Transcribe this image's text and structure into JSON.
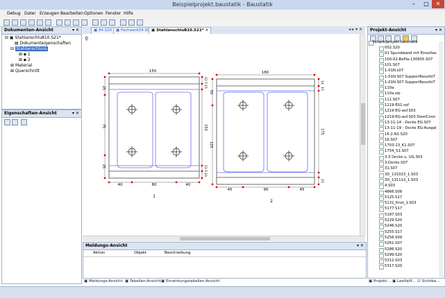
{
  "window": {
    "title": "Beispielprojekt.baustatik - Baustatik",
    "minimize": "–",
    "maximize": "□",
    "close": "✕"
  },
  "menu": [
    "Debug",
    "Datei",
    "Erzeugen",
    "Bearbeiten",
    "Optionen",
    "Fenster",
    "Hilfe"
  ],
  "doc_panel": {
    "title": "Dokumenten-Ansicht",
    "pin": "▾ ✕",
    "root": "Stahlanschlu810.S21*",
    "items": [
      "Dokumenteigenschaften",
      "Stahlanschluss",
      "1",
      "2",
      "Material",
      "Querschnitt"
    ]
  },
  "props_panel": {
    "title": "Eigenschaften-Ansicht",
    "pin": "▾ ✕"
  },
  "tabs": [
    "84.S20",
    "Fachwerk54.S03",
    "StahlanschluB10.S21*"
  ],
  "drawing": {
    "left": {
      "top_dim": "150",
      "bottom_dims": [
        "40",
        "80",
        "40"
      ],
      "left_dims": [
        "25",
        "75",
        "25"
      ],
      "right_dims": [
        "12.5",
        "15",
        "150",
        "11.5",
        "10"
      ],
      "label": "1"
    },
    "right": {
      "top_dim": "180",
      "bottom_dims": [
        "45",
        "90",
        "45"
      ],
      "left_dims": [
        "50",
        "125"
      ],
      "right_dims": [
        "14",
        "15",
        "175",
        "15"
      ],
      "label": "2"
    }
  },
  "meldungen": {
    "title": "Meldungs-Ansicht",
    "pin": "▾ ✕",
    "columns": [
      "Aktion",
      "Objekt",
      "Beschreibung"
    ]
  },
  "bottom_tabs": [
    "Meldungs-Ansicht",
    "Tabellen-Ansicht",
    "Einwirkungstabellen-Ansicht"
  ],
  "project_panel": {
    "title": "Projekt-Ansicht",
    "pin": "▾ ✕",
    "root": "Beispielprojekt.baustatik",
    "items": [
      "002.S20",
      "01 Spundwand mit Einzellas",
      "100-02-BoPla-130605.S07",
      "101.S07",
      "1-01N.s07",
      "1-01N.S07.SupportResultsT",
      "1-01N.S07.SupportResultsT",
      "110a",
      "110a.zip",
      "111.S07",
      "1219-E01.sof",
      "1219-EG-auf.S03",
      "1219-EG-auf.S03.SteelConn",
      "13-11-14 - Decke EG.S07",
      "13-11-19 - Decke EG-Ausgal",
      "16.2-N1.S20",
      "16.S07",
      "1703-13_K1.S07",
      "1754_S1.S07",
      "3.3 Decke u. UG.S03",
      "3.Decke.S07",
      "31.S07",
      "3D_131023_1.S03",
      "3D_131112_1.S03",
      "4.S03",
      "4866.S08",
      "5125.S17",
      "5131_Knst_1.S03",
      "5177.S17",
      "5187.S03",
      "5229.S20",
      "5246.S20",
      "5255.S17",
      "5256.S09",
      "5261.S07",
      "5286.S20",
      "5299.S20",
      "5312.S03",
      "5317.S20"
    ],
    "bottom_tabs": [
      "Projekt-...",
      "Lastfallf...",
      "Sichtba..."
    ]
  }
}
